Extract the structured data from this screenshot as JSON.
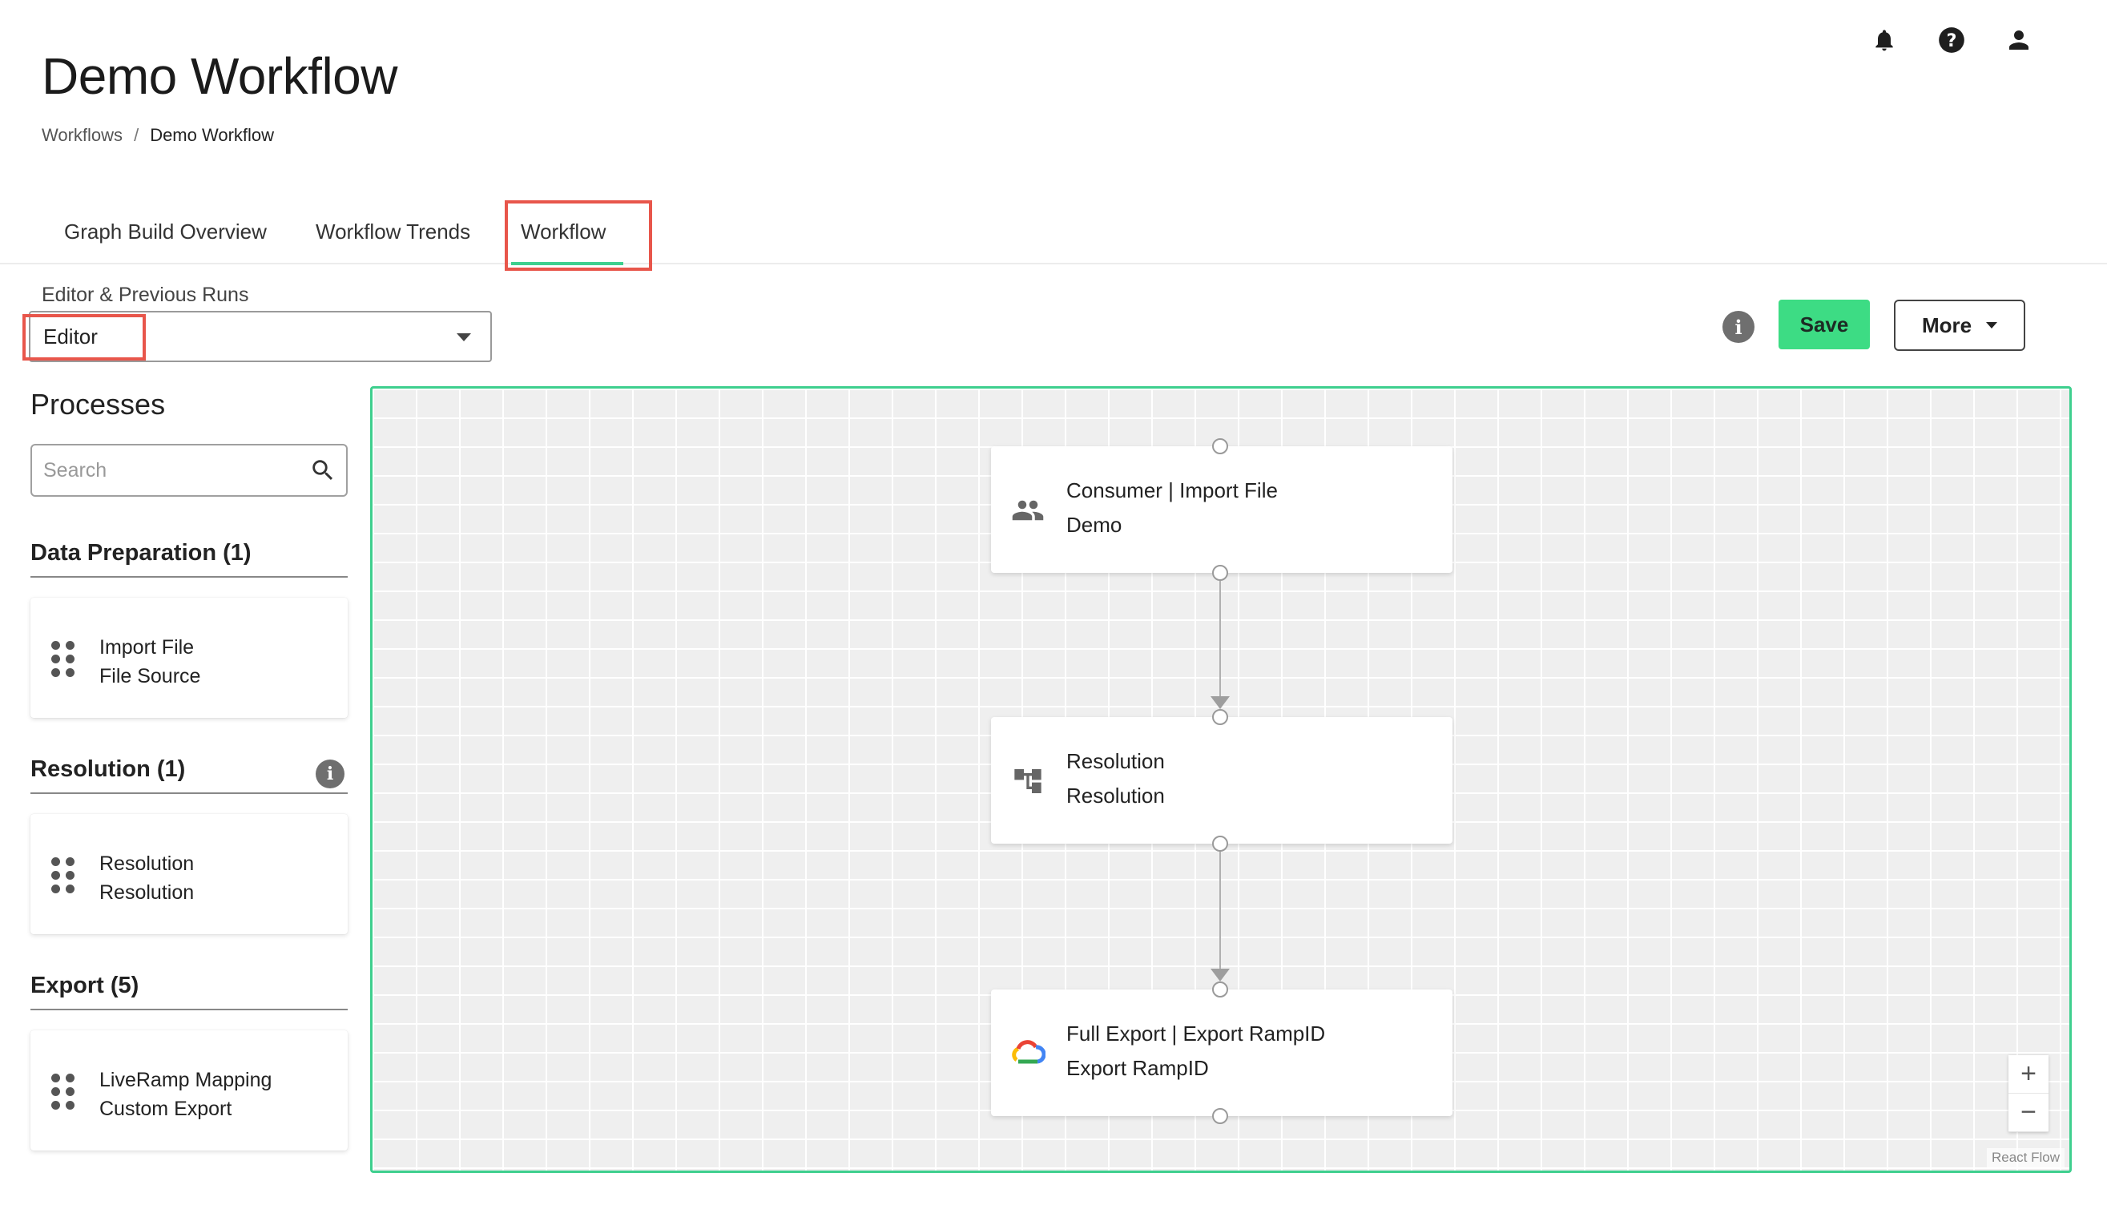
{
  "page": {
    "title": "Demo Workflow",
    "breadcrumb": {
      "root": "Workflows",
      "separator": "/",
      "current": "Demo Workflow"
    }
  },
  "header_icons": [
    "bell-icon",
    "help-icon",
    "account-icon"
  ],
  "tabs": [
    {
      "label": "Graph Build Overview"
    },
    {
      "label": "Workflow Trends"
    },
    {
      "label": "Workflow",
      "active": true
    }
  ],
  "editor_select": {
    "label": "Editor & Previous Runs",
    "value": "Editor"
  },
  "toolbar": {
    "save_label": "Save",
    "more_label": "More"
  },
  "sidebar": {
    "title": "Processes",
    "search_placeholder": "Search",
    "sections": [
      {
        "heading": "Data Preparation (1)",
        "items": [
          {
            "line1": "Import File",
            "line2": "File Source"
          }
        ]
      },
      {
        "heading": "Resolution (1)",
        "items": [
          {
            "line1": "Resolution",
            "line2": "Resolution"
          }
        ]
      },
      {
        "heading": "Export (5)",
        "items": [
          {
            "line1": "LiveRamp Mapping",
            "line2": "Custom Export"
          }
        ]
      }
    ]
  },
  "canvas": {
    "nodes": [
      {
        "title": "Consumer | Import File",
        "subtitle": "Demo",
        "icon": "people-icon"
      },
      {
        "title": "Resolution",
        "subtitle": "Resolution",
        "icon": "resolution-flow-icon"
      },
      {
        "title": "Full Export | Export RampID",
        "subtitle": "Export RampID",
        "icon": "google-cloud-icon"
      }
    ],
    "zoom_in": "+",
    "zoom_out": "−",
    "attribution": "React Flow"
  },
  "colors": {
    "accent": "#3ecf8e",
    "save_button": "#3ddc84",
    "highlight_box": "#e8564b"
  }
}
